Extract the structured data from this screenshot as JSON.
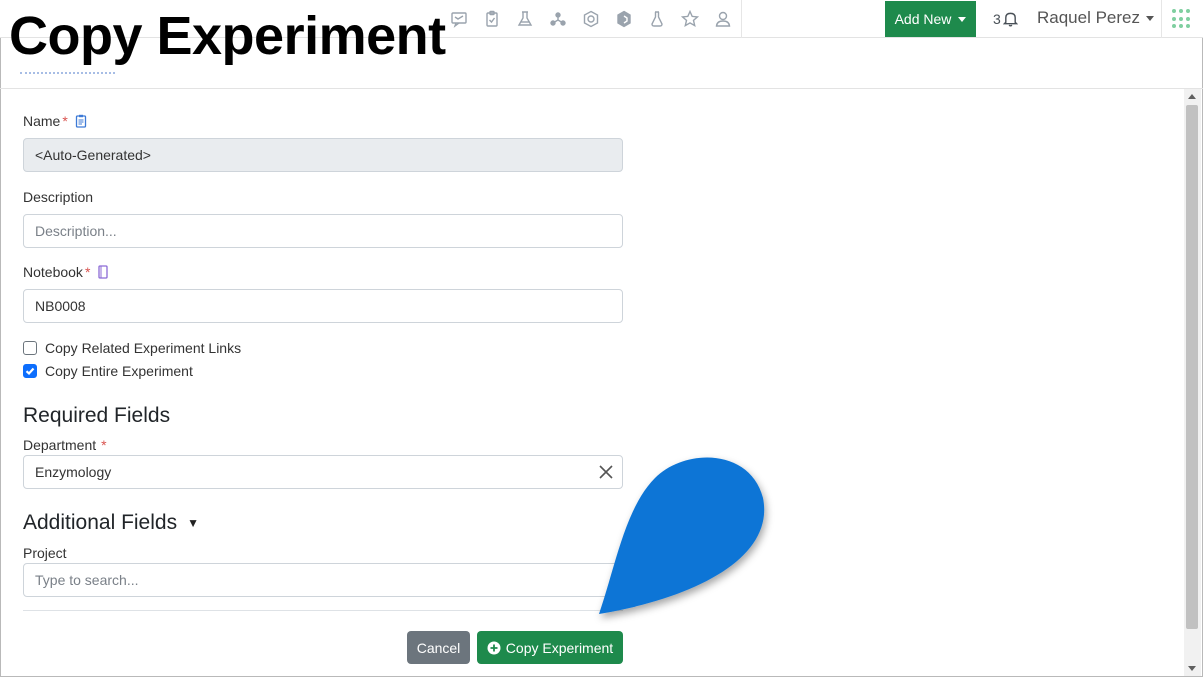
{
  "overlay_title": "Copy Experiment",
  "nav": {
    "icons": [
      "chat-icon",
      "clipboard-icon",
      "lab-icon",
      "molecule-icon",
      "hexagon-icon",
      "droplet-icon",
      "flask-icon",
      "star-icon",
      "user-icon"
    ],
    "add_new_label": "Add New",
    "notification_count": "3",
    "user_name": "Raquel Perez"
  },
  "form": {
    "name_label": "Name",
    "name_value": "<Auto-Generated>",
    "description_label": "Description",
    "description_placeholder": "Description...",
    "notebook_label": "Notebook",
    "notebook_value": "NB0008",
    "required_marker": "*",
    "checkboxes": [
      {
        "label": "Copy Related Experiment Links",
        "checked": false
      },
      {
        "label": "Copy Entire Experiment",
        "checked": true
      }
    ],
    "required_section_title": "Required Fields",
    "department_label": "Department",
    "department_value": "Enzymology",
    "additional_section_title": "Additional Fields",
    "additional_toggle": "▼",
    "project_label": "Project",
    "project_placeholder": "Type to search..."
  },
  "buttons": {
    "cancel_label": "Cancel",
    "copy_label": "Copy Experiment"
  },
  "colors": {
    "primary_green": "#1e8a4c",
    "checkbox_blue": "#0d6efd",
    "pointer_blue": "#0a74d6",
    "required_red": "#d9534f"
  }
}
